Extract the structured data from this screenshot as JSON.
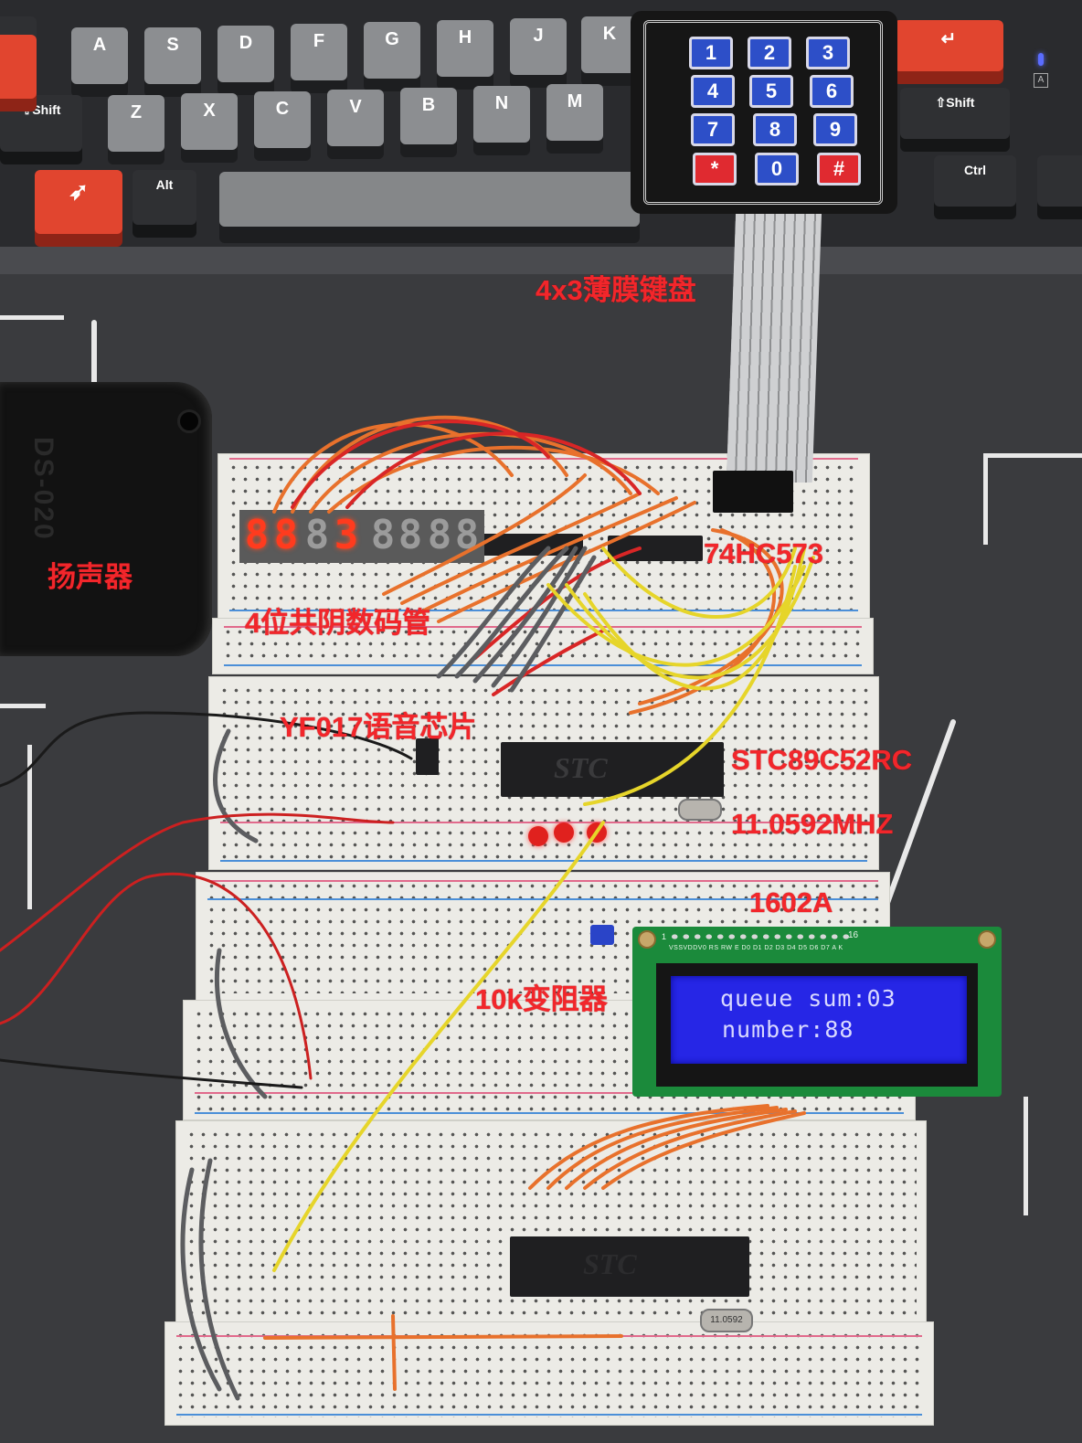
{
  "keyboard": {
    "keys_row_home": [
      "A",
      "S",
      "D",
      "F",
      "G",
      "H",
      "J",
      "K"
    ],
    "keys_row_bottom": [
      "Z",
      "X",
      "C",
      "V",
      "B",
      "N",
      "M"
    ],
    "modifier_keys": {
      "left_shift": "⇧Shift",
      "right_shift": "⇧Shift",
      "alt": "Alt",
      "ctrl": "Ctrl",
      "enter": "↵"
    },
    "indicator_label": "A",
    "accent_color": "#e1452f"
  },
  "keypad": {
    "keys": [
      "1",
      "2",
      "3",
      "4",
      "5",
      "6",
      "7",
      "8",
      "9",
      "*",
      "0",
      "#"
    ],
    "key_color": "#2d4fc8",
    "special_key_color": "#e02a30"
  },
  "speaker": {
    "emboss_text": "DS-020"
  },
  "seven_segment": {
    "digits": [
      "8",
      "8",
      "",
      "3"
    ],
    "lit": [
      true,
      true,
      false,
      true
    ],
    "secondary_digits": [
      "8",
      "8",
      "8",
      "8"
    ],
    "lit_color": "#ff3b1e"
  },
  "lcd": {
    "pin_labels": "VSSVDDV0 RS RW E D0 D1 D2 D3 D4 D5 D6 D7 A K",
    "pin_start": "1",
    "pin_end": "16",
    "line1": "queue sum:03",
    "line2": "number:88",
    "backlight_color": "#2626e6"
  },
  "chips": {
    "mcu_brand": "STC",
    "mcu2_brand": "STC",
    "crystal_marking": "11.0592"
  },
  "annotations": {
    "keypad": "4x3薄膜键盘",
    "speaker": "扬声器",
    "seven_segment": "4位共阴数码管",
    "latch": "74HC573",
    "voice_chip": "YF017语音芯片",
    "mcu": "STC89C52RC",
    "crystal": "11.0592MHZ",
    "lcd": "1602A",
    "potentiometer": "10k变阻器",
    "color": "#f2262b"
  }
}
